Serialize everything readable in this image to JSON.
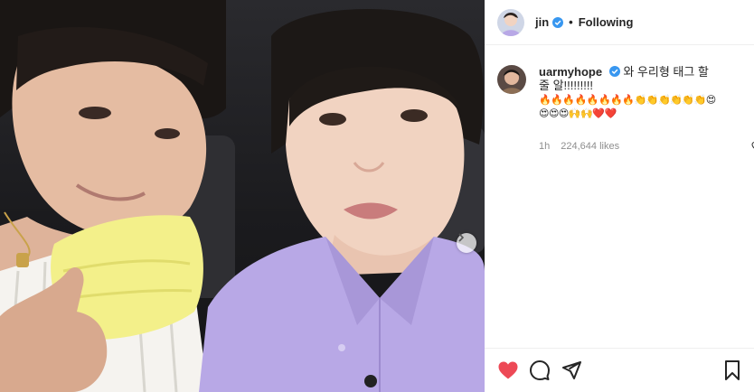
{
  "post": {
    "author": "jin",
    "follow_state": "Following",
    "separator": "•",
    "verified": true
  },
  "comment": {
    "username": "uarmyhope",
    "verified": true,
    "text": "와 우리형 태그 할 줄 알!!!!!!!!!",
    "emojis": "🔥🔥🔥🔥🔥🔥🔥🔥👏👏👏👏👏👏😍😍😍😍🙌🙌❤️❤️",
    "time": "1h",
    "likes": "224,644 likes"
  },
  "icons": {
    "like": "heart-filled-icon",
    "comment": "comment-bubble-icon",
    "share": "paper-plane-icon",
    "save": "bookmark-icon",
    "next": "chevron-right-icon"
  },
  "colors": {
    "like_active": "#ed4956",
    "verified_badge": "#3897f0",
    "shirt": "#b8a8e6",
    "sweater": "#f3f08a"
  }
}
